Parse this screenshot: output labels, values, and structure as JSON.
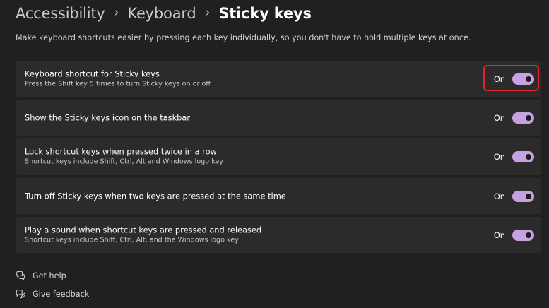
{
  "breadcrumb": {
    "items": [
      "Accessibility",
      "Keyboard"
    ],
    "separator": "›",
    "current": "Sticky keys"
  },
  "description": "Make keyboard shortcuts easier by pressing each key individually, so you don't have to hold multiple keys at once.",
  "settings": [
    {
      "title": "Keyboard shortcut for Sticky keys",
      "subtitle": "Press the Shift key 5 times to turn Sticky keys on or off",
      "state_label": "On",
      "on": true
    },
    {
      "title": "Show the Sticky keys icon on the taskbar",
      "subtitle": "",
      "state_label": "On",
      "on": true
    },
    {
      "title": "Lock shortcut keys when pressed twice in a row",
      "subtitle": "Shortcut keys include Shift, Ctrl, Alt and Windows logo key",
      "state_label": "On",
      "on": true
    },
    {
      "title": "Turn off Sticky keys when two keys are pressed at the same time",
      "subtitle": "",
      "state_label": "On",
      "on": true
    },
    {
      "title": "Play a sound when shortcut keys are pressed and released",
      "subtitle": "Shortcut keys include Shift, Ctrl, Alt, and the Windows logo key",
      "state_label": "On",
      "on": true
    }
  ],
  "footer": {
    "get_help": "Get help",
    "give_feedback": "Give feedback"
  },
  "icons": {
    "get_help": "help-chat-icon",
    "give_feedback": "feedback-icon"
  },
  "colors": {
    "toggle_on": "#c7a2e0",
    "highlight": "#e0242e",
    "background": "#202020",
    "card": "#2b2b2b"
  }
}
